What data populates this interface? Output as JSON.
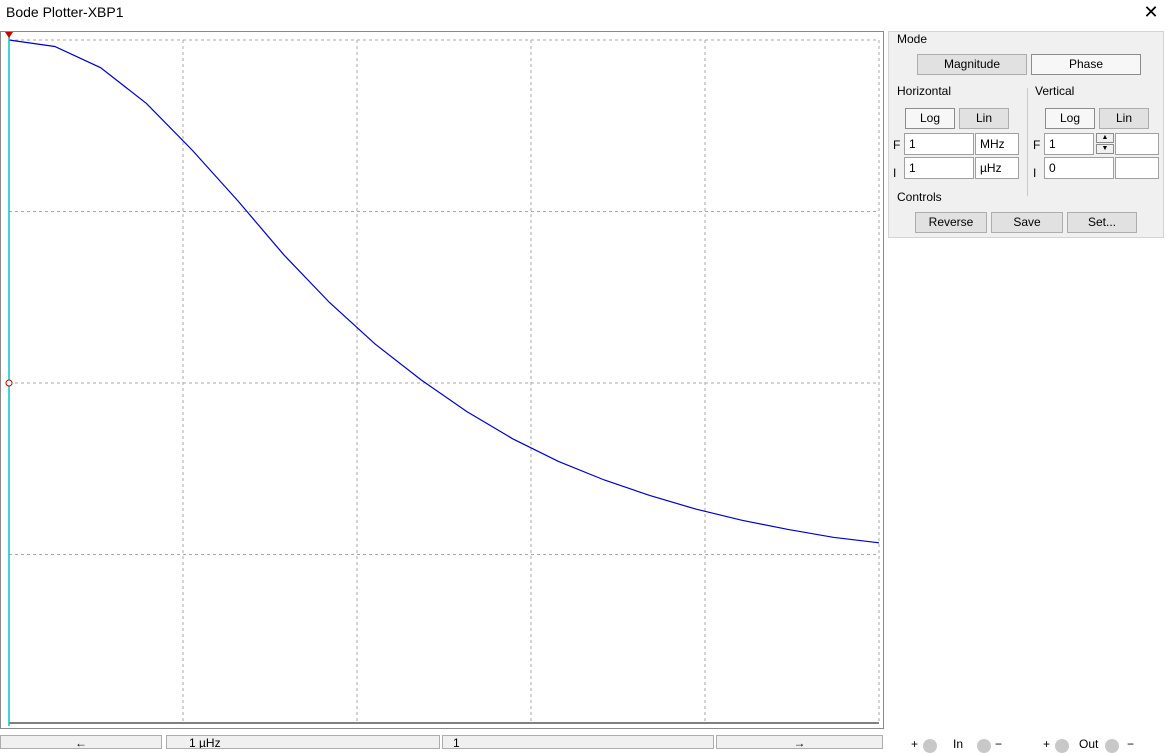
{
  "window": {
    "title": "Bode Plotter-XBP1",
    "close_glyph": "✕"
  },
  "colors": {
    "curve": "#0000cc",
    "cursor": "#00c8c8",
    "grid": "#a8a8a8",
    "cursor_marker": "#cc0000"
  },
  "plot": {
    "grid_columns": 5,
    "grid_rows": 4,
    "curve_samples": [
      1.0,
      0.987,
      0.945,
      0.874,
      0.781,
      0.68,
      0.573,
      0.478,
      0.395,
      0.324,
      0.261,
      0.207,
      0.162,
      0.125,
      0.094,
      0.067,
      0.045,
      0.027,
      0.011,
      0.0
    ],
    "curve_end_fraction": 0.733,
    "cursor_position_fraction": 0.0
  },
  "panel": {
    "mode": {
      "label": "Mode",
      "magnitude": "Magnitude",
      "phase": "Phase"
    },
    "horizontal": {
      "label": "Horizontal",
      "log": "Log",
      "lin": "Lin",
      "f_label": "F",
      "f_value": "1",
      "f_unit": "MHz",
      "i_label": "I",
      "i_value": "1",
      "i_unit": "µHz"
    },
    "vertical": {
      "label": "Vertical",
      "log": "Log",
      "lin": "Lin",
      "f_label": "F",
      "f_value": "1",
      "f_unit": "",
      "i_label": "I",
      "i_value": "0",
      "i_unit": ""
    },
    "controls": {
      "label": "Controls",
      "reverse": "Reverse",
      "save": "Save",
      "set": "Set..."
    }
  },
  "bottom": {
    "left_arrow": "←",
    "frequency_readout": "1 µHz",
    "value_readout": "1",
    "right_arrow": "→"
  },
  "terminals": {
    "in_label": "In",
    "out_label": "Out",
    "plus": "+",
    "minus": "−"
  }
}
